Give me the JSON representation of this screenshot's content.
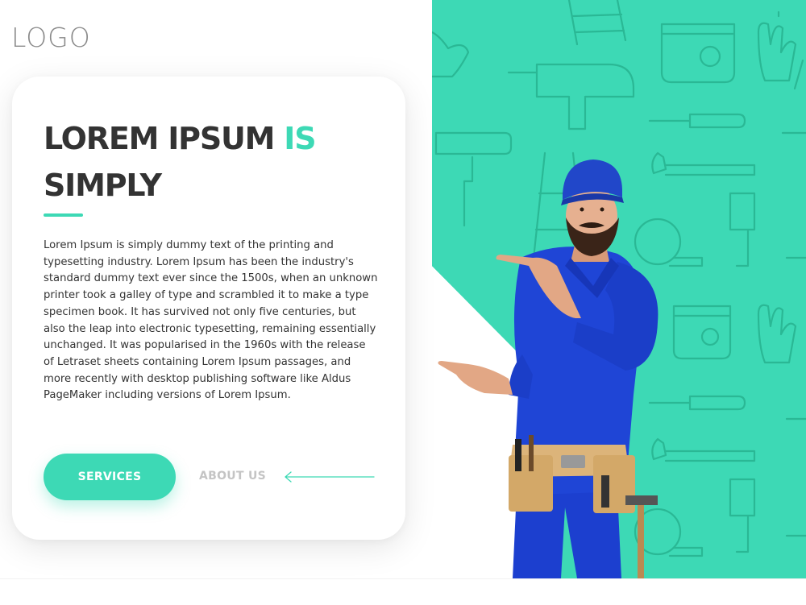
{
  "logo": {
    "text": "LOGO"
  },
  "hero": {
    "headline_main": "LOREM IPSUM",
    "headline_accent": "IS",
    "headline_second_line": "SIMPLY",
    "body": "Lorem Ipsum is simply dummy text of the printing and typesetting industry. Lorem Ipsum has been the industry's standard dummy text ever since the 1500s, when an unknown printer took a galley of type and scrambled it to make a type specimen book. It has survived not only five centuries, but also the leap into electronic typesetting, remaining essentially unchanged. It was popularised in the 1960s with the release of Letraset sheets containing Lorem Ipsum passages, and more recently with desktop publishing software like Aldus PageMaker including versions of Lorem Ipsum.",
    "services_label": "SERVICES",
    "about_label": "ABOUT US",
    "arrow_icon": "arrow-left-icon"
  },
  "image": {
    "subject": "worker-pointing-illustration",
    "pattern": "tools-line-pattern"
  },
  "colors": {
    "accent": "#3dd9b5",
    "pattern_stroke": "#2ab895",
    "heading": "#333333",
    "muted_link": "#c4c4c4",
    "logo": "#8a8a8a",
    "overall_blue": "#1c3fcf",
    "cap_blue": "#2147c9",
    "belt_tan": "#dcb47a"
  }
}
